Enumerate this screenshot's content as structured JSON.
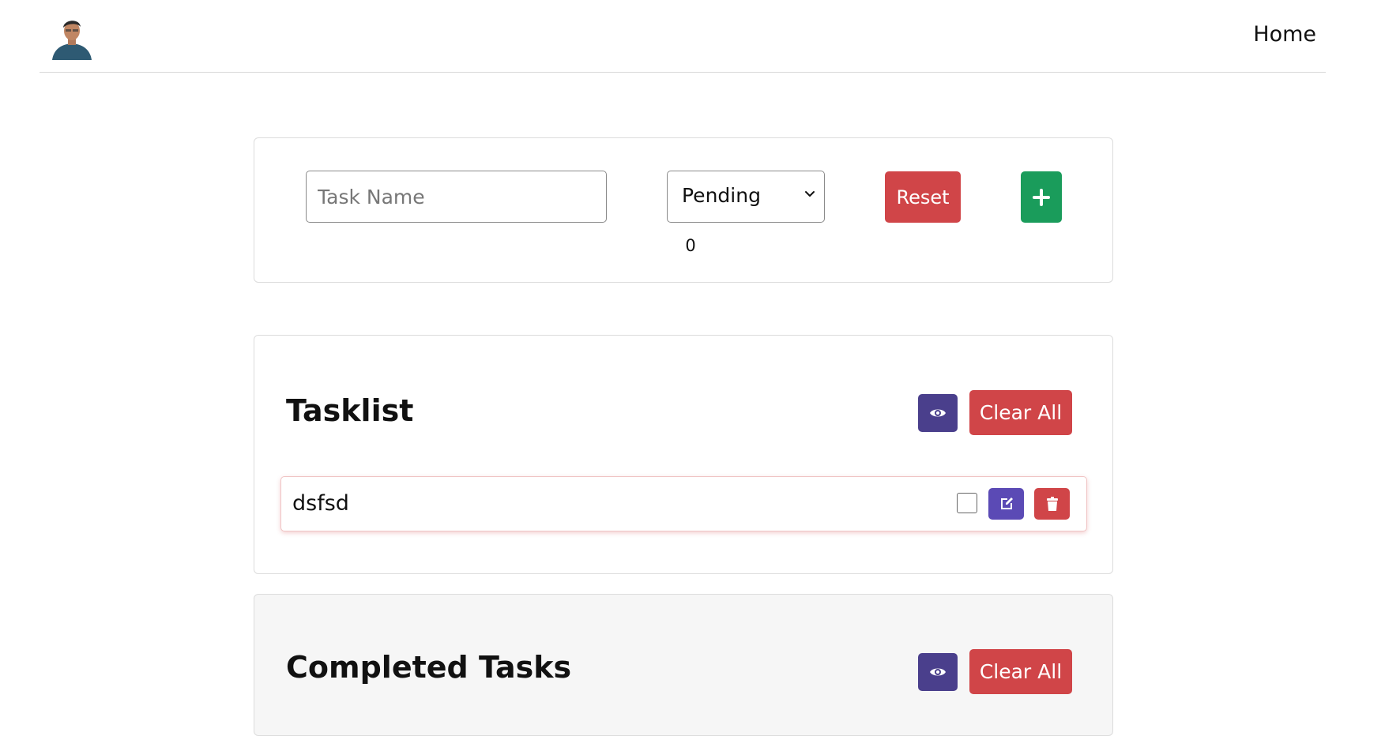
{
  "nav": {
    "home_label": "Home"
  },
  "form": {
    "task_name_placeholder": "Task Name",
    "task_name_value": "",
    "status_selected": "Pending",
    "counter": "0",
    "reset_label": "Reset",
    "add_icon": "plus-icon"
  },
  "tasklist": {
    "title": "Tasklist",
    "view_icon": "eye-icon",
    "clear_label": "Clear All",
    "items": [
      {
        "name": "dsfsd",
        "checked": false,
        "edit_icon": "edit-icon",
        "delete_icon": "trash-icon"
      }
    ]
  },
  "completed": {
    "title": "Completed Tasks",
    "view_icon": "eye-icon",
    "clear_label": "Clear All"
  },
  "colors": {
    "danger": "#d04548",
    "success": "#1a9c5b",
    "view_button": "#4a3f8c",
    "edit_button": "#5b4ab5",
    "completed_background": "#f6f6f6"
  }
}
